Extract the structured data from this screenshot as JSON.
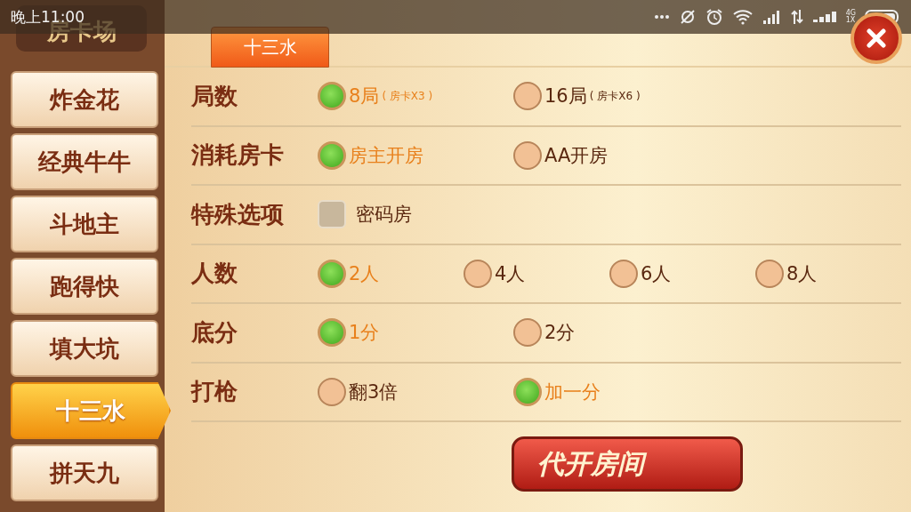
{
  "status_bar": {
    "time": "晚上11:00",
    "network": [
      "4G",
      "1X"
    ]
  },
  "sidebar": {
    "title": "房卡场",
    "items": [
      {
        "label": "炸金花",
        "selected": false
      },
      {
        "label": "经典牛牛",
        "selected": false
      },
      {
        "label": "斗地主",
        "selected": false
      },
      {
        "label": "跑得快",
        "selected": false
      },
      {
        "label": "填大坑",
        "selected": false
      },
      {
        "label": "十三水",
        "selected": true
      },
      {
        "label": "拼天九",
        "selected": false
      }
    ]
  },
  "tabs": [
    {
      "label": "十三水",
      "selected": true
    }
  ],
  "settings": [
    {
      "label": "局数",
      "kind": "radio",
      "options": [
        {
          "label": "8局",
          "note": "( 房卡X3 )",
          "selected": true
        },
        {
          "label": "16局",
          "note": "( 房卡X6 )",
          "selected": false
        }
      ]
    },
    {
      "label": "消耗房卡",
      "kind": "radio",
      "options": [
        {
          "label": "房主开房",
          "selected": true
        },
        {
          "label": "AA开房",
          "selected": false
        }
      ]
    },
    {
      "label": "特殊选项",
      "kind": "checkbox",
      "options": [
        {
          "label": "密码房",
          "checked": false
        }
      ]
    },
    {
      "label": "人数",
      "kind": "radio",
      "options": [
        {
          "label": "2人",
          "selected": true
        },
        {
          "label": "4人",
          "selected": false
        },
        {
          "label": "6人",
          "selected": false
        },
        {
          "label": "8人",
          "selected": false
        }
      ]
    },
    {
      "label": "底分",
      "kind": "radio",
      "options": [
        {
          "label": "1分",
          "selected": true
        },
        {
          "label": "2分",
          "selected": false
        }
      ]
    },
    {
      "label": "打枪",
      "kind": "radio",
      "options": [
        {
          "label": "翻3倍",
          "selected": false
        },
        {
          "label": "加一分",
          "selected": true
        }
      ]
    }
  ],
  "action_button": "代开房间"
}
